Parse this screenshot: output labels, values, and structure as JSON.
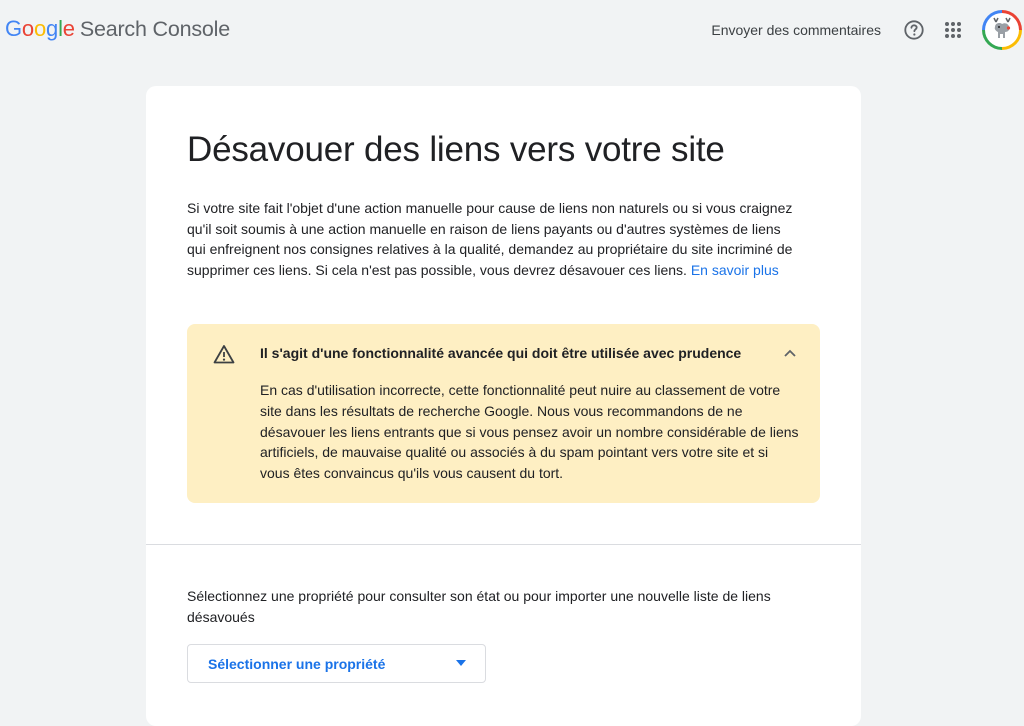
{
  "header": {
    "brand_letters": [
      {
        "char": "G",
        "color": "#4285f4"
      },
      {
        "char": "o",
        "color": "#ea4335"
      },
      {
        "char": "o",
        "color": "#fbbc04"
      },
      {
        "char": "g",
        "color": "#4285f4"
      },
      {
        "char": "l",
        "color": "#34a853"
      },
      {
        "char": "e",
        "color": "#ea4335"
      }
    ],
    "product_name": "Search Console",
    "feedback_label": "Envoyer des commentaires",
    "icons": [
      "help-icon",
      "apps-grid-icon",
      "account-avatar"
    ]
  },
  "page": {
    "title": "Désavouer des liens vers votre site",
    "intro_text": "Si votre site fait l'objet d'une action manuelle pour cause de liens non naturels ou si vous craignez qu'il soit soumis à une action manuelle en raison de liens payants ou d'autres systèmes de liens qui enfreignent nos consignes relatives à la qualité, demandez au propriétaire du site incriminé de supprimer ces liens. Si cela n'est pas possible, vous devrez désavouer ces liens.",
    "learn_more_label": "En savoir plus"
  },
  "warning": {
    "title": "Il s'agit d'une fonctionnalité avancée qui doit être utilisée avec prudence",
    "body": "En cas d'utilisation incorrecte, cette fonctionnalité peut nuire au classement de votre site dans les résultats de recherche Google. Nous vous recommandons de ne désavouer les liens entrants que si vous pensez avoir un nombre considérable de liens artificiels, de mauvaise qualité ou associés à du spam pointant vers votre site et si vous êtes convaincus qu'ils vous causent du tort.",
    "expanded": true,
    "background_color": "#feefc3"
  },
  "property_selector": {
    "description": "Sélectionnez une propriété pour consulter son état ou pour importer une nouvelle liste de liens désavoués",
    "button_label": "Sélectionner une propriété"
  },
  "colors": {
    "link": "#1a73e8",
    "background": "#f1f3f4",
    "card": "#ffffff"
  }
}
